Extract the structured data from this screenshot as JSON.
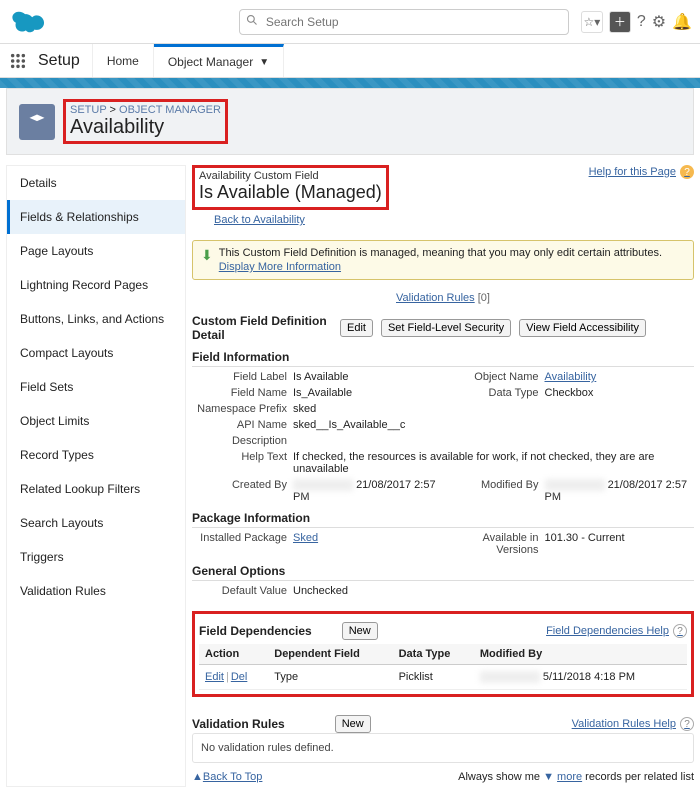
{
  "header": {
    "search_placeholder": "Search Setup",
    "nav_title": "Setup",
    "tabs": {
      "home": "Home",
      "object_manager": "Object Manager"
    }
  },
  "breadcrumb": {
    "root": "SETUP",
    "current": "OBJECT MANAGER"
  },
  "page_title": "Availability",
  "sidebar": {
    "items": [
      "Details",
      "Fields & Relationships",
      "Page Layouts",
      "Lightning Record Pages",
      "Buttons, Links, and Actions",
      "Compact Layouts",
      "Field Sets",
      "Object Limits",
      "Record Types",
      "Related Lookup Filters",
      "Search Layouts",
      "Triggers",
      "Validation Rules"
    ],
    "active_index": 1
  },
  "custom_field": {
    "pre_title": "Availability Custom Field",
    "title": "Is Available (Managed)",
    "back_link": "Back to Availability",
    "help_link": "Help for this Page",
    "notice_text": "This Custom Field Definition is managed, meaning that you may only edit certain attributes.",
    "notice_more": "Display More Information",
    "validation_link": "Validation Rules",
    "validation_count": "[0]"
  },
  "detail": {
    "section_title": "Custom Field Definition Detail",
    "buttons": {
      "edit": "Edit",
      "fls": "Set Field-Level Security",
      "vfa": "View Field Accessibility"
    },
    "fi_heading": "Field Information",
    "rows": {
      "field_label_k": "Field Label",
      "field_label_v": "Is Available",
      "object_name_k": "Object Name",
      "object_name_v": "Availability",
      "field_name_k": "Field Name",
      "field_name_v": "Is_Available",
      "data_type_k": "Data Type",
      "data_type_v": "Checkbox",
      "ns_prefix_k": "Namespace Prefix",
      "ns_prefix_v": "sked",
      "api_name_k": "API Name",
      "api_name_v": "sked__Is_Available__c",
      "description_k": "Description",
      "description_v": "",
      "help_text_k": "Help Text",
      "help_text_v": "If checked, the resources is available for work, if not checked, they are are unavailable",
      "created_by_k": "Created By",
      "created_by_date": "21/08/2017 2:57 PM",
      "modified_by_k": "Modified By",
      "modified_by_date": "21/08/2017 2:57 PM"
    },
    "pkg_heading": "Package Information",
    "pkg": {
      "installed_k": "Installed Package",
      "installed_v": "Sked",
      "avail_k": "Available in Versions",
      "avail_v": "101.30 - Current"
    },
    "gen_heading": "General Options",
    "gen": {
      "default_k": "Default Value",
      "default_v": "Unchecked"
    }
  },
  "dependencies": {
    "heading": "Field Dependencies",
    "new_btn": "New",
    "help_link": "Field Dependencies Help",
    "cols": {
      "action": "Action",
      "dep_field": "Dependent Field",
      "data_type": "Data Type",
      "mod_by": "Modified By"
    },
    "row": {
      "edit": "Edit",
      "del": "Del",
      "dep_field": "Type",
      "data_type": "Picklist",
      "mod_date": "5/11/2018 4:18 PM"
    }
  },
  "validation_rules": {
    "heading": "Validation Rules",
    "new_btn": "New",
    "help_link": "Validation Rules Help",
    "empty_msg": "No validation rules defined."
  },
  "footer": {
    "back_to_top": "Back To Top",
    "always_show": "Always show me",
    "more": "more",
    "records_tail": "records per related list"
  }
}
